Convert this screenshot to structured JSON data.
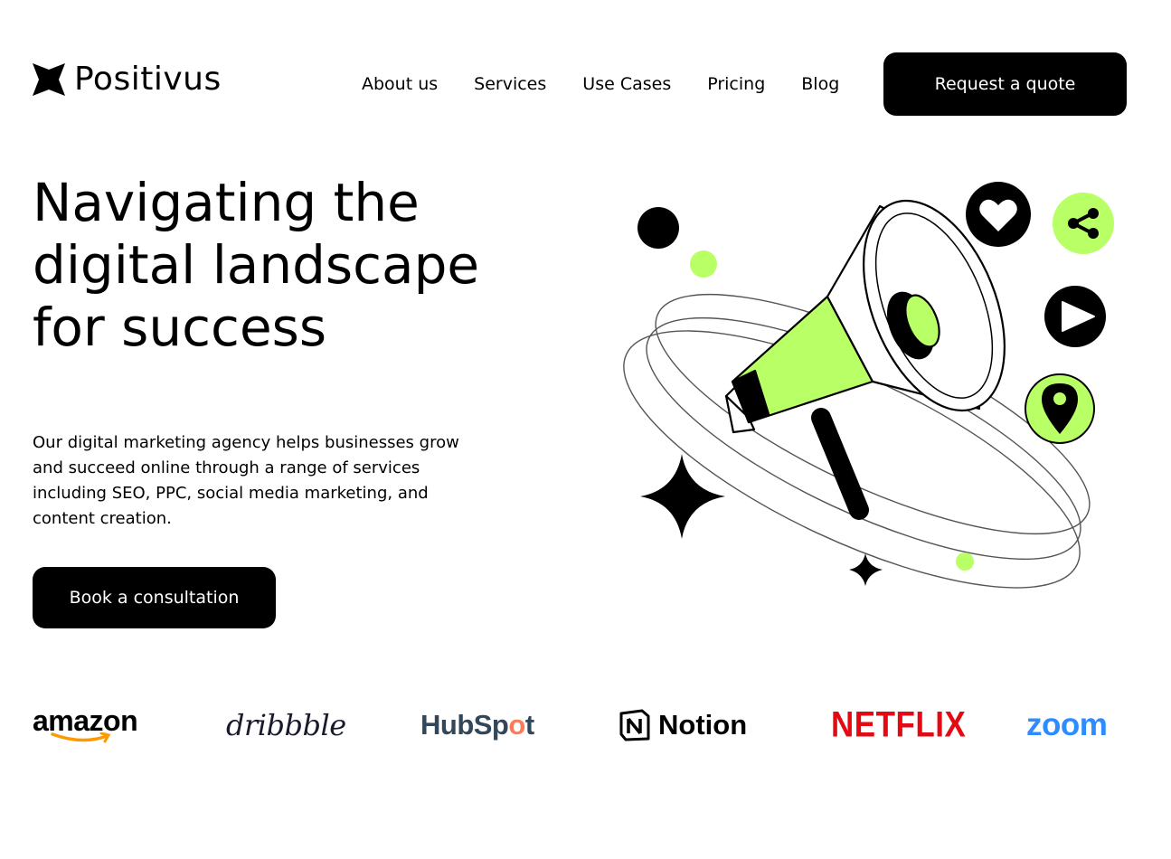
{
  "brand": {
    "name": "Positivus",
    "accent": "#B9FF66",
    "dark": "#000000"
  },
  "nav": {
    "items": [
      "About us",
      "Services",
      "Use Cases",
      "Pricing",
      "Blog"
    ],
    "cta": "Request a quote"
  },
  "hero": {
    "headline_lines": [
      "Navigating the",
      "digital landscape",
      "for success"
    ],
    "description": "Our digital marketing agency helps businesses grow and succeed online through a range of services including SEO, PPC, social media marketing, and content creation.",
    "cta": "Book a consultation",
    "illustration_icons": [
      "megaphone-icon",
      "heart-icon",
      "share-icon",
      "play-icon",
      "location-pin-icon",
      "sparkle-icon"
    ]
  },
  "logos": {
    "amazon": "amazon",
    "dribbble": "dribbble",
    "hubspot_pre": "HubSp",
    "hubspot_dot": "o",
    "hubspot_post": "t",
    "notion": "Notion",
    "netflix": "NETFLIX",
    "zoom": "zoom"
  }
}
